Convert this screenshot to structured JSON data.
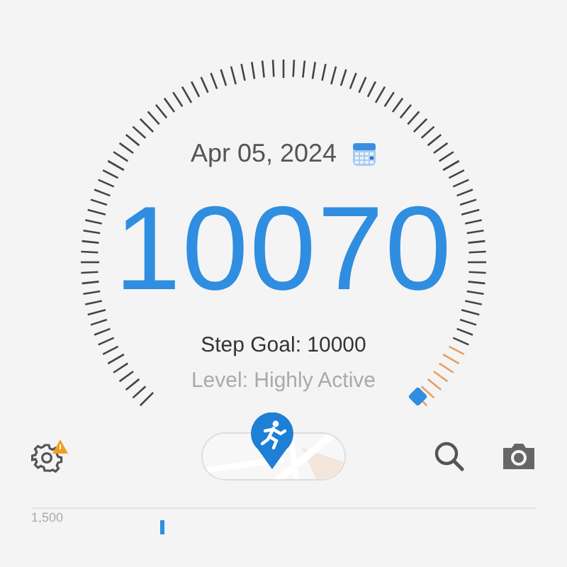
{
  "gauge": {
    "date": "Apr 05, 2024",
    "steps": "10070",
    "goal": "Step Goal: 10000",
    "activity_level": "Level: Highly Active"
  },
  "toolbar": {
    "settings_warning": true,
    "map_toggle": {
      "on": true
    }
  },
  "chart": {
    "y_label": "1,500"
  }
}
